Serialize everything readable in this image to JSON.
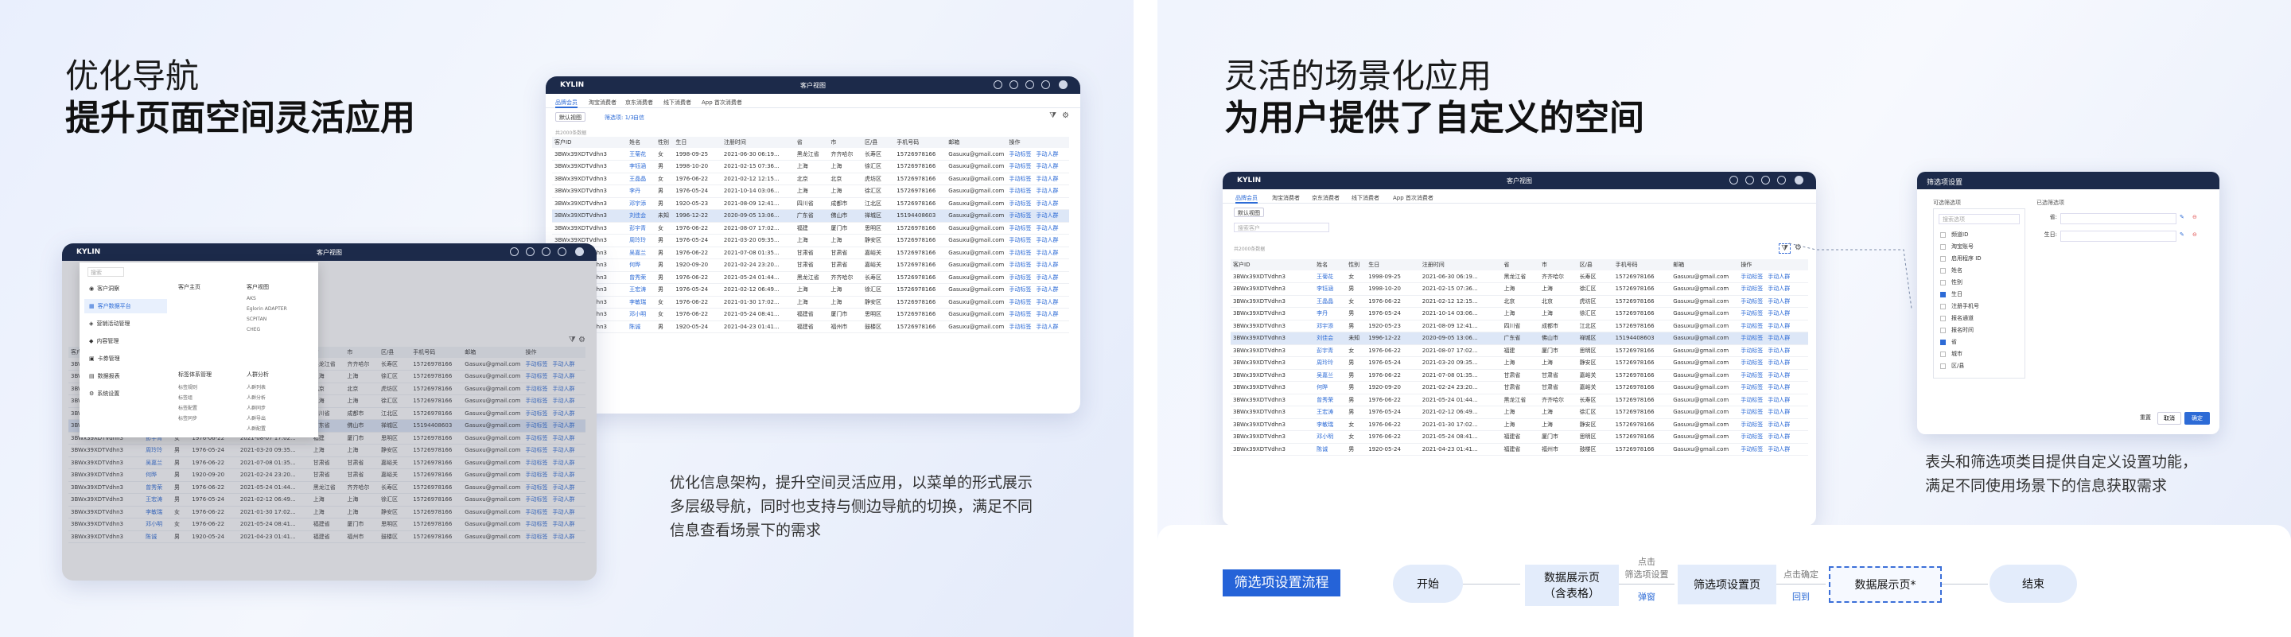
{
  "left": {
    "headline_line1": "优化导航",
    "headline_line2": "提升页面空间灵活应用",
    "description_lines": [
      "优化信息架构，提升空间灵活应用，以菜单的形式展示",
      "多层级导航，同时也支持与侧边导航的切换，满足不同",
      "信息查看场景下的需求"
    ]
  },
  "right": {
    "headline_line1": "灵活的场景化应用",
    "headline_line2": "为用户提供了自定义的空间",
    "description_lines": [
      "表头和筛选项类目提供自定义设置功能，",
      "满足不同使用场景下的信息获取需求"
    ]
  },
  "app": {
    "logo": "KYLIN",
    "title": "客户视图",
    "tabs": [
      "品牌会员",
      "淘宝消费者",
      "京东消费者",
      "线下消费者",
      "App 首次消费者"
    ],
    "view_select": "默认视图",
    "filter_links": [
      "筛选项: 1/3",
      "自信"
    ],
    "search_placeholder": "搜索客户",
    "count_text": "共2000条数据",
    "columns": [
      "客户ID",
      "姓名",
      "性别",
      "生日",
      "注册时间",
      "省",
      "市",
      "区/县",
      "手机号码",
      "邮箱",
      "操作"
    ],
    "action_label_1": "手动标签",
    "action_label_2": "手动人群",
    "rows": [
      [
        "3BWx39XDTVdhn3",
        "王菊花",
        "女",
        "1998-09-25",
        "2021-06-30 06:19...",
        "黑龙江省",
        "齐齐哈尔",
        "长寿区",
        "15726978166",
        "Gasuxu@gmail.com"
      ],
      [
        "3BWx39XDTVdhn3",
        "李钰涵",
        "男",
        "1998-10-20",
        "2021-02-15 07:36...",
        "上海",
        "上海",
        "徐汇区",
        "15726978166",
        "Gasuxu@gmail.com"
      ],
      [
        "3BWx39XDTVdhn3",
        "王晶晶",
        "女",
        "1976-06-22",
        "2021-02-12 12:15...",
        "北京",
        "北京",
        "虎坊区",
        "15726978166",
        "Gasuxu@gmail.com"
      ],
      [
        "3BWx39XDTVdhn3",
        "李丹",
        "男",
        "1976-05-24",
        "2021-10-14 03:06...",
        "上海",
        "上海",
        "徐汇区",
        "15726978166",
        "Gasuxu@gmail.com"
      ],
      [
        "3BWx39XDTVdhn3",
        "邓宇添",
        "男",
        "1920-05-23",
        "2021-08-09 12:41...",
        "四川省",
        "成都市",
        "江北区",
        "15726978166",
        "Gasuxu@gmail.com"
      ],
      [
        "3BWx39XDTVdhn3",
        "刘佳会",
        "未知",
        "1996-12-22",
        "2020-09-05 13:06...",
        "广东省",
        "佛山市",
        "禅城区",
        "15194408603",
        "Gasuxu@gmail.com"
      ],
      [
        "3BWx39XDTVdhn3",
        "彭宇青",
        "女",
        "1976-06-22",
        "2021-08-07 17:02...",
        "福建",
        "厦门市",
        "思明区",
        "15726978166",
        "Gasuxu@gmail.com"
      ],
      [
        "3BWx39XDTVdhn3",
        "周玲玲",
        "男",
        "1976-05-24",
        "2021-03-20 09:35...",
        "上海",
        "上海",
        "静安区",
        "15726978166",
        "Gasuxu@gmail.com"
      ],
      [
        "3BWx39XDTVdhn3",
        "吴嘉兰",
        "男",
        "1976-06-22",
        "2021-07-08 01:35...",
        "甘肃省",
        "甘肃省",
        "嘉峪关",
        "15726978166",
        "Gasuxu@gmail.com"
      ],
      [
        "3BWx39XDTVdhn3",
        "何晔",
        "男",
        "1920-09-20",
        "2021-02-24 23:20...",
        "甘肃省",
        "甘肃省",
        "嘉峪关",
        "15726978166",
        "Gasuxu@gmail.com"
      ],
      [
        "3BWx39XDTVdhn3",
        "曾秀荣",
        "男",
        "1976-06-22",
        "2021-05-24 01:44...",
        "黑龙江省",
        "齐齐哈尔",
        "长寿区",
        "15726978166",
        "Gasuxu@gmail.com"
      ],
      [
        "3BWx39XDTVdhn3",
        "王宏涛",
        "男",
        "1976-05-24",
        "2021-02-12 06:49...",
        "上海",
        "上海",
        "徐汇区",
        "15726978166",
        "Gasuxu@gmail.com"
      ],
      [
        "3BWx39XDTVdhn3",
        "李敏瑞",
        "女",
        "1976-06-22",
        "2021-01-30 17:02...",
        "上海",
        "上海",
        "静安区",
        "15726978166",
        "Gasuxu@gmail.com"
      ],
      [
        "3BWx39XDTVdhn3",
        "邓小明",
        "女",
        "1976-06-22",
        "2021-05-24 08:41...",
        "福建省",
        "厦门市",
        "思明区",
        "15726978166",
        "Gasuxu@gmail.com"
      ],
      [
        "3BWx39XDTVdhn3",
        "陈诚",
        "男",
        "1920-05-24",
        "2021-04-23 01:41...",
        "福建省",
        "福州市",
        "鼓楼区",
        "15726978166",
        "Gasuxu@gmail.com"
      ]
    ]
  },
  "nav_menu": {
    "search_placeholder": "搜索",
    "sidebar_items": [
      "客户洞察",
      "客户数据平台",
      "营销活动管理",
      "内容管理",
      "卡券管理",
      "数据报表",
      "系统设置"
    ],
    "col1_title": "客户主页",
    "col2_title": "客户视图",
    "col2_items": [
      "AKS",
      "Eglorin ADAPTER",
      "SCPITAN",
      "CHEG"
    ],
    "col3_title": "标签体系管理",
    "col3_items": [
      "标签规则",
      "标签组",
      "标签配置",
      "标签同步"
    ],
    "col4_title": "人群分析",
    "col4_items": [
      "人群列表",
      "人群分析",
      "人群同步",
      "人群导出",
      "人群配置"
    ]
  },
  "dialog": {
    "title": "筛选项设置",
    "left_title": "可选筛选项",
    "right_title": "已选筛选项",
    "search_placeholder": "搜索选项",
    "options": [
      {
        "label": "频道ID",
        "checked": false
      },
      {
        "label": "淘宝账号",
        "checked": false
      },
      {
        "label": "启用程序 ID",
        "checked": false
      },
      {
        "label": "姓名",
        "checked": false
      },
      {
        "label": "性别",
        "checked": false
      },
      {
        "label": "生日",
        "checked": true
      },
      {
        "label": "注册手机号",
        "checked": false
      },
      {
        "label": "报名通道",
        "checked": false
      },
      {
        "label": "报名时间",
        "checked": false
      },
      {
        "label": "省",
        "checked": true
      },
      {
        "label": "城市",
        "checked": false
      },
      {
        "label": "区/县",
        "checked": false
      }
    ],
    "selected": [
      "省:",
      "生日:"
    ],
    "reset": "重置",
    "cancel": "取消",
    "confirm": "确定"
  },
  "flow": {
    "title": "筛选项设置流程",
    "start": "开始",
    "step1_line1": "数据展示页",
    "step1_line2": "（含表格）",
    "arrow1_top_line1": "点击",
    "arrow1_top_line2": "筛选项设置",
    "arrow1_bottom": "弹窗",
    "step2": "筛选项设置页",
    "arrow2_top": "点击确定",
    "arrow2_bottom": "回到",
    "step3": "数据展示页*",
    "end": "结束"
  },
  "colors": {
    "accent": "#2d6bd6",
    "titlebar": "#1c2a4a",
    "flow_title": "#2563d8"
  }
}
